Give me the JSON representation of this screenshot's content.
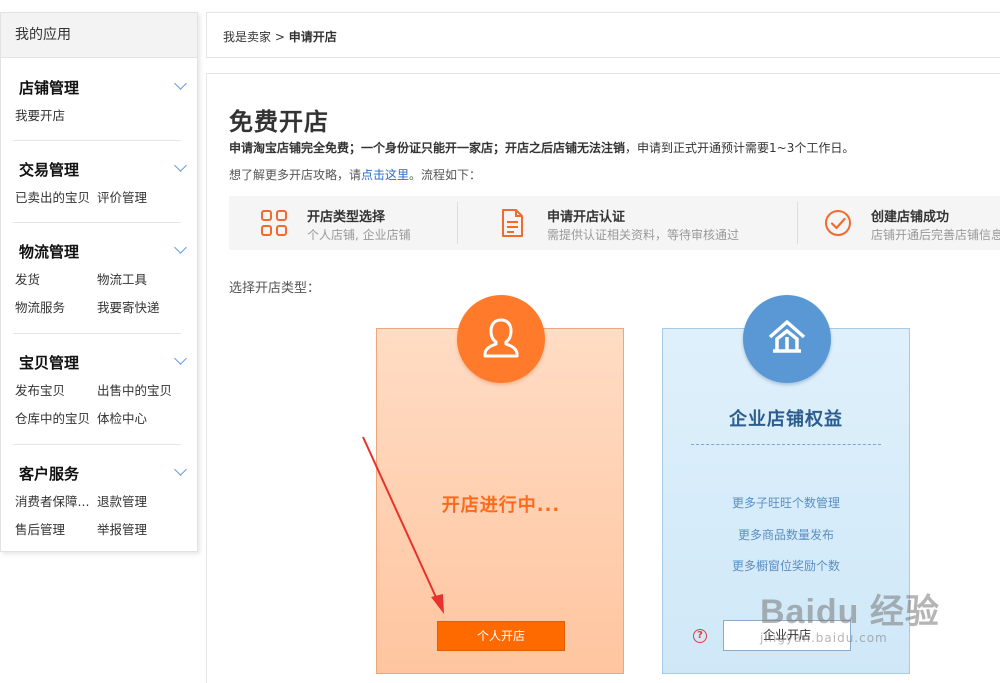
{
  "sidebar": {
    "title": "我的应用",
    "groups": [
      {
        "title": "店铺管理",
        "links": [
          "我要开店"
        ]
      },
      {
        "title": "交易管理",
        "links": [
          "已卖出的宝贝",
          "评价管理"
        ]
      },
      {
        "title": "物流管理",
        "links": [
          "发货",
          "物流工具",
          "物流服务",
          "我要寄快递"
        ]
      },
      {
        "title": "宝贝管理",
        "links": [
          "发布宝贝",
          "出售中的宝贝",
          "仓库中的宝贝",
          "体检中心"
        ]
      },
      {
        "title": "客户服务",
        "links": [
          "消费者保障...",
          "退款管理",
          "售后管理",
          "举报管理"
        ]
      }
    ]
  },
  "breadcrumb": {
    "parent": "我是卖家",
    "sep": ">",
    "current": "申请开店"
  },
  "main": {
    "title": "免费开店",
    "desc_strong": "申请淘宝店铺完全免费；一个身份证只能开一家店；开店之后店铺无法注销",
    "desc_rest": "，申请到正式开通预计需要1~3个工作日。",
    "desc2_pre": "想了解更多开店攻略，请",
    "desc2_link": "点击这里",
    "desc2_post": "。流程如下：",
    "steps": [
      {
        "title": "开店类型选择",
        "sub": "个人店铺, 企业店铺",
        "icon": "grid-icon"
      },
      {
        "title": "申请开店认证",
        "sub": "需提供认证相关资料，等待审核通过",
        "icon": "document-icon"
      },
      {
        "title": "创建店铺成功",
        "sub": "店铺开通后完善店铺信息",
        "icon": "check-circle-icon"
      }
    ],
    "choose_label": "选择开店类型："
  },
  "cards": {
    "personal": {
      "status": "开店进行中...",
      "button": "个人开店"
    },
    "enterprise": {
      "title": "企业店铺权益",
      "benefits": [
        "更多子旺旺个数管理",
        "更多商品数量发布",
        "更多橱窗位奖励个数"
      ],
      "help": "?",
      "button": "企业开店"
    }
  },
  "watermark": {
    "big": "Baidu 经验",
    "small": "jingyan.baidu.com"
  },
  "colors": {
    "accent_orange": "#ff6a00",
    "accent_blue": "#5a97d5",
    "link_blue": "#2a6bc8"
  }
}
